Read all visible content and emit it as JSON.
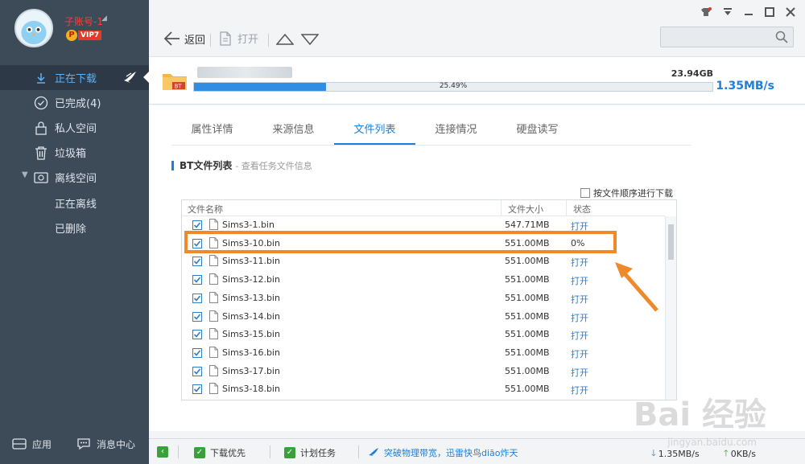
{
  "sidebar": {
    "username": "子账号-1",
    "vip_level": "VIP7",
    "items": [
      {
        "label": "正在下载",
        "icon": "download-icon"
      },
      {
        "label": "已完成(4)",
        "icon": "check-circle-icon"
      },
      {
        "label": "私人空间",
        "icon": "lock-icon"
      },
      {
        "label": "垃圾箱",
        "icon": "trash-icon"
      },
      {
        "label": "离线空间",
        "icon": "cloud-folder-icon"
      }
    ],
    "sub_items": [
      "正在离线",
      "已删除"
    ],
    "bottom": {
      "apps_label": "应用",
      "messages_label": "消息中心"
    }
  },
  "toolbar": {
    "back_label": "返回",
    "open_label": "打开"
  },
  "task": {
    "badge": "BT",
    "size": "23.94GB",
    "progress_text": "25.49%",
    "progress": 0.2549,
    "speed": "1.35MB/s"
  },
  "tabs": [
    "属性详情",
    "来源信息",
    "文件列表",
    "连接情况",
    "硬盘读写"
  ],
  "active_tab": "文件列表",
  "section": {
    "title": "BT文件列表",
    "subtitle": "- 查看任务文件信息"
  },
  "order_option": "按文件顺序进行下载",
  "table": {
    "headers": {
      "name": "文件名称",
      "size": "文件大小",
      "status": "状态"
    },
    "rows": [
      {
        "name": "Sims3-1.bin",
        "size": "547.71MB",
        "status": "打开"
      },
      {
        "name": "Sims3-10.bin",
        "size": "551.00MB",
        "status": "0%"
      },
      {
        "name": "Sims3-11.bin",
        "size": "551.00MB",
        "status": "打开"
      },
      {
        "name": "Sims3-12.bin",
        "size": "551.00MB",
        "status": "打开"
      },
      {
        "name": "Sims3-13.bin",
        "size": "551.00MB",
        "status": "打开"
      },
      {
        "name": "Sims3-14.bin",
        "size": "551.00MB",
        "status": "打开"
      },
      {
        "name": "Sims3-15.bin",
        "size": "551.00MB",
        "status": "打开"
      },
      {
        "name": "Sims3-16.bin",
        "size": "551.00MB",
        "status": "打开"
      },
      {
        "name": "Sims3-17.bin",
        "size": "551.00MB",
        "status": "打开"
      },
      {
        "name": "Sims3-18.bin",
        "size": "551.00MB",
        "status": "打开"
      }
    ]
  },
  "statusbar": {
    "priority_label": "下载优先",
    "schedule_label": "计划任务",
    "promo_text": "突破物理带宽，迅雷快鸟diāo炸天",
    "down_speed": "1.35MB/s",
    "up_speed": "0KB/s"
  },
  "watermark": {
    "text": "Bai 经验",
    "url": "jingyan.baidu.com"
  },
  "colors": {
    "accent": "#1f7fd8",
    "highlight": "#ef8a2c",
    "sidebar": "#3d4a58"
  }
}
